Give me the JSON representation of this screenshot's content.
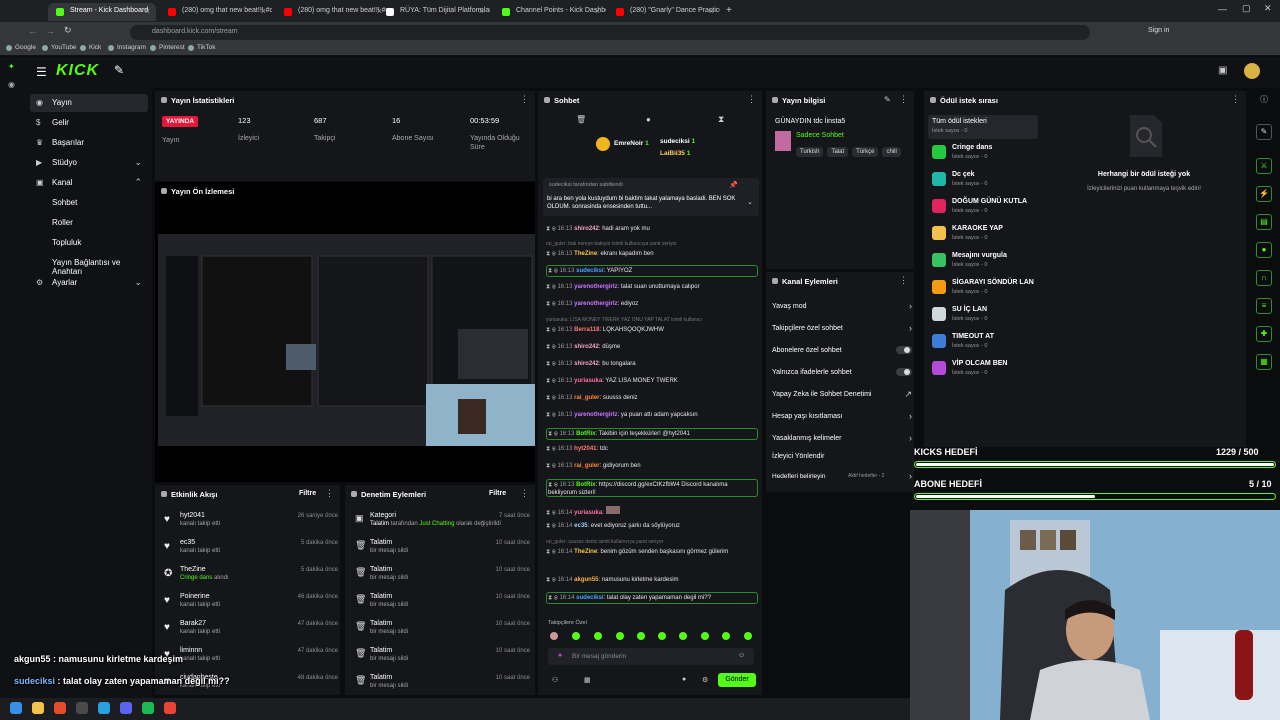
{
  "browser": {
    "tabs": [
      {
        "label": "Stream - Kick Dashboard",
        "color": "#53fc18",
        "active": true
      },
      {
        "label": "(280) omg that new beat!!! #ca",
        "color": "#ff0000"
      },
      {
        "label": "(280) omg that new beat!!! #c",
        "color": "#ff0000"
      },
      {
        "label": "RÜYA: Tüm Dijital Platformlard",
        "color": "#ffffff"
      },
      {
        "label": "Channel Points - Kick Dashboa",
        "color": "#53fc18"
      },
      {
        "label": "(280) \"Gnarly\" Dance Practice | K",
        "color": "#ff0000"
      }
    ],
    "url": "dashboard.kick.com/stream",
    "sign_in": "Sign in",
    "bookmarks": [
      "Google",
      "YouTube",
      "Kick",
      "Instagram",
      "Pinterest",
      "TikTok"
    ]
  },
  "app": {
    "logo": "KICK"
  },
  "sidebar": {
    "items": [
      {
        "label": "Yayın",
        "icon": "broadcast-icon",
        "active": true
      },
      {
        "label": "Gelir",
        "icon": "dollar-icon"
      },
      {
        "label": "Başarılar",
        "icon": "trophy-icon"
      },
      {
        "label": "Stüdyo",
        "icon": "studio-icon",
        "chevron": "down"
      },
      {
        "label": "Kanal",
        "icon": "channel-icon",
        "chevron": "up"
      },
      {
        "label": "Sohbet",
        "sub": true
      },
      {
        "label": "Roller",
        "sub": true
      },
      {
        "label": "Topluluk",
        "sub": true
      },
      {
        "label": "Yayın Bağlantısı ve Anahtarı",
        "sub": true
      },
      {
        "label": "Ayarlar",
        "icon": "gear-icon",
        "chevron": "down"
      }
    ]
  },
  "stats": {
    "title": "Yayın İstatistikleri",
    "live": "YAYINDA",
    "live_label": "Yayın",
    "items": [
      {
        "value": "123",
        "label": "İzleyici"
      },
      {
        "value": "687",
        "label": "Takipçi"
      },
      {
        "value": "16",
        "label": "Abone Sayısı"
      },
      {
        "value": "00:53:59",
        "label": "Yayında Olduğu Süre"
      }
    ]
  },
  "preview": {
    "title": "Yayın Ön İzlemesi"
  },
  "activity": {
    "title": "Etkinlik Akışı",
    "filter": "Filtre",
    "rows": [
      {
        "name": "hyt2041",
        "sub": "kanalı takip etti",
        "time": "26 saniye önce",
        "icon": "heart-icon"
      },
      {
        "name": "ec35",
        "sub": "kanalı takip etti",
        "time": "5 dakika önce",
        "icon": "heart-icon"
      },
      {
        "name": "TheZine",
        "sub": "Cringe dans",
        "sub2": "alındı",
        "time": "5 dakika önce",
        "icon": "reward-icon"
      },
      {
        "name": "Poinerine",
        "sub": "kanalı takip etti",
        "time": "46 dakika önce",
        "icon": "heart-icon"
      },
      {
        "name": "Barak27",
        "sub": "kanalı takip etti",
        "time": "47 dakika önce",
        "icon": "heart-icon"
      },
      {
        "name": "liminnn",
        "sub": "kanalı takip etti",
        "time": "47 dakika önce",
        "icon": "heart-icon"
      },
      {
        "name": "ciudanbeste",
        "sub": "kanalı takip etti",
        "time": "48 dakika önce",
        "icon": "heart-icon"
      }
    ]
  },
  "moderation": {
    "title": "Denetim Eylemleri",
    "filter": "Filtre",
    "rows": [
      {
        "name": "Kategori",
        "sub": "Talatim",
        "sub_mid": "tarafından",
        "sub_hl": "Just Chatting",
        "sub_end": "olarak değiştirildi",
        "time": "7 saat önce"
      },
      {
        "name": "Talatim",
        "sub": "bir mesajı sildi",
        "time": "10 saat önce"
      },
      {
        "name": "Talatim",
        "sub": "bir mesajı sildi",
        "time": "10 saat önce"
      },
      {
        "name": "Talatim",
        "sub": "bir mesajı sildi",
        "time": "10 saat önce"
      },
      {
        "name": "Talatim",
        "sub": "bir mesajı sildi",
        "time": "10 saat önce"
      },
      {
        "name": "Talatim",
        "sub": "bir mesajı sildi",
        "time": "10 saat önce"
      },
      {
        "name": "Talatim",
        "sub": "bir mesajı sildi",
        "time": "10 saat önce"
      }
    ]
  },
  "chat": {
    "title": "Sohbet",
    "top_users": [
      {
        "name": "EmreNoir",
        "count": "1"
      },
      {
        "name": "sudeciksi",
        "count": "1"
      },
      {
        "name": "LaiBii35",
        "count": "1"
      }
    ],
    "pinned_by": "sudeciksi tarafından sabitlendi",
    "pinned_text": "bi ara ben yola kustuydum bi baktim takat yalamaya basladi. BEN SOK OLDUM. sonrasinda ensesinden tuttu...",
    "messages": [
      {
        "time": "16:13",
        "user": "shiro242",
        "color": "#f8a5c2",
        "text": "hadi aram yok mu"
      },
      {
        "time": "",
        "user": "",
        "color": "#777",
        "text": "rai_guler: bak nereye bakıyor isimli kullanıcıya yanıt veriyor",
        "sys": true
      },
      {
        "time": "16:13",
        "user": "TheZine",
        "color": "#f7c948",
        "text": "ekranı kapadım ben"
      },
      {
        "time": "16:13",
        "user": "sudeciksi",
        "color": "#4aa3ff",
        "text": "YAPIYOZ",
        "hl": true
      },
      {
        "time": "16:13",
        "user": "yarenothergirlz",
        "color": "#c977ff",
        "text": "talat suan unuttumaya calıpor"
      },
      {
        "time": "16:13",
        "user": "yarenothergirlz",
        "color": "#c977ff",
        "text": "ediyoz"
      },
      {
        "time": "",
        "user": "",
        "color": "#777",
        "text": "yuriasuka: LİSA MONEY TWERK YAZ ONU YAP TALAT isimli kullanıcı",
        "sys": true
      },
      {
        "time": "16:13",
        "user": "Berra118",
        "color": "#ff7a7a",
        "text": "LQKAHSQOQKJWHW"
      },
      {
        "time": "16:13",
        "user": "shiro242",
        "color": "#f8a5c2",
        "text": "düşme"
      },
      {
        "time": "16:13",
        "user": "shiro242",
        "color": "#f8a5c2",
        "text": "bu tongalara"
      },
      {
        "time": "16:13",
        "user": "yuriasuka",
        "color": "#ff6fa5",
        "text": "YAZ LİSA MONEY TWERK"
      },
      {
        "time": "16:13",
        "user": "rai_guler",
        "color": "#ff8a3d",
        "text": "suusss deniz"
      },
      {
        "time": "16:13",
        "user": "yarenothergirlz",
        "color": "#c977ff",
        "text": "ya puan attı adam yapcaksın"
      },
      {
        "time": "16:13",
        "user": "BotRix",
        "color": "#53fc18",
        "text": "Takibin için teşekkürler! @hyt2041",
        "hl": true
      },
      {
        "time": "16:13",
        "user": "hyt2041",
        "color": "#ff7a7a",
        "text": "tdc"
      },
      {
        "time": "16:13",
        "user": "rai_guler",
        "color": "#ff8a3d",
        "text": "gidiyorum ben"
      },
      {
        "time": "16:13",
        "user": "BotRix",
        "color": "#53fc18",
        "text": "https://discord.gg/exCtKzfbW4 Discord kanalıma bekliyorum sizleri!",
        "hl": true
      },
      {
        "time": "16:14",
        "user": "yuriasuka",
        "color": "#ff6fa5",
        "text": ""
      },
      {
        "time": "16:14",
        "user": "ec35",
        "color": "#9ad0ff",
        "text": "evet ediyoruz şarkı da söylüyoruz"
      },
      {
        "time": "",
        "user": "",
        "color": "#777",
        "text": "rai_guler: suusss deniz isimli kullanıcıya yanıt veriyor",
        "sys": true
      },
      {
        "time": "16:14",
        "user": "TheZine",
        "color": "#f7c948",
        "text": "benim gözüm senden başkasını görmez gülerim"
      },
      {
        "time": "16:14",
        "user": "akgun55",
        "color": "#ffb347",
        "text": "namusunu kirletme kardesim"
      },
      {
        "time": "16:14",
        "user": "sudeciksi",
        "color": "#4aa3ff",
        "text": "talat olay zaten yapamaman degil mi??",
        "hl": true
      }
    ],
    "followers_only": "Takipçilere Özel",
    "input_placeholder": "Bir mesaj gönderin",
    "send": "Gönder"
  },
  "stream_info": {
    "title": "Yayın bilgisi",
    "stream_title": "GÜNAYDIN tdc İinsta5",
    "category": "Sadece Sohbet",
    "tags": [
      "Turkish",
      "Talat",
      "Türkçe",
      "chill"
    ]
  },
  "channel_actions": {
    "title": "Kanal Eylemleri",
    "items": [
      {
        "label": "Yavaş mod",
        "type": "chevron"
      },
      {
        "label": "Takipçilere özel sohbet",
        "type": "chevron"
      },
      {
        "label": "Abonelere özel sohbet",
        "type": "toggle"
      },
      {
        "label": "Yalnızca ifadelerle sohbet",
        "type": "toggle"
      },
      {
        "label": "Yapay Zeka ile Sohbet Denetimi",
        "type": "external"
      },
      {
        "label": "Hesap yaşı kısıtlaması",
        "type": "chevron"
      },
      {
        "label": "Yasaklanmış kelimeler",
        "type": "chevron"
      },
      {
        "label": "İzleyici Yönlendir",
        "type": "none"
      },
      {
        "label": "Hedefleri belirleyin",
        "type": "chevron",
        "status": "Aktif hedefler - 2"
      }
    ]
  },
  "rewards": {
    "title": "Ödül istek sırası",
    "all": "Tüm ödül istekleri",
    "count_label": "İstek sayısı - 0",
    "items": [
      {
        "name": "Cringe dans",
        "color": "#27c93f"
      },
      {
        "name": "Dc çek",
        "color": "#1fb8a8"
      },
      {
        "name": "DOĞUM GÜNÜ KUTLA",
        "color": "#e0245e"
      },
      {
        "name": "KARAOKE YAP",
        "color": "#f2c14e"
      },
      {
        "name": "Mesajını vurgula",
        "color": "#3ac262"
      },
      {
        "name": "SİGARAYI SÖNDÜR LAN",
        "color": "#f39c12"
      },
      {
        "name": "SU İÇ LAN",
        "color": "#cfd8dc"
      },
      {
        "name": "TIMEOUT AT",
        "color": "#3f7bd8"
      },
      {
        "name": "VİP OLCAM BEN",
        "color": "#b44ad8"
      }
    ],
    "empty_title": "Herhangi bir ödül isteği yok",
    "empty_sub": "İzleyicilerinizi puan kullanmaya teşvik edin!"
  },
  "goals": {
    "kicks": {
      "label": "KICKS HEDEFİ",
      "value": "1229 / 500",
      "fraction": 1.0
    },
    "subs": {
      "label": "ABONE HEDEFİ",
      "value": "5 / 10",
      "fraction": 0.5
    }
  },
  "overlay_chat": [
    {
      "user": "akgun55",
      "text": "namusunu kirletme kardeşim"
    },
    {
      "user": "sudeciksi",
      "text": "talat olay zaten yapamaman değil mi??"
    }
  ]
}
